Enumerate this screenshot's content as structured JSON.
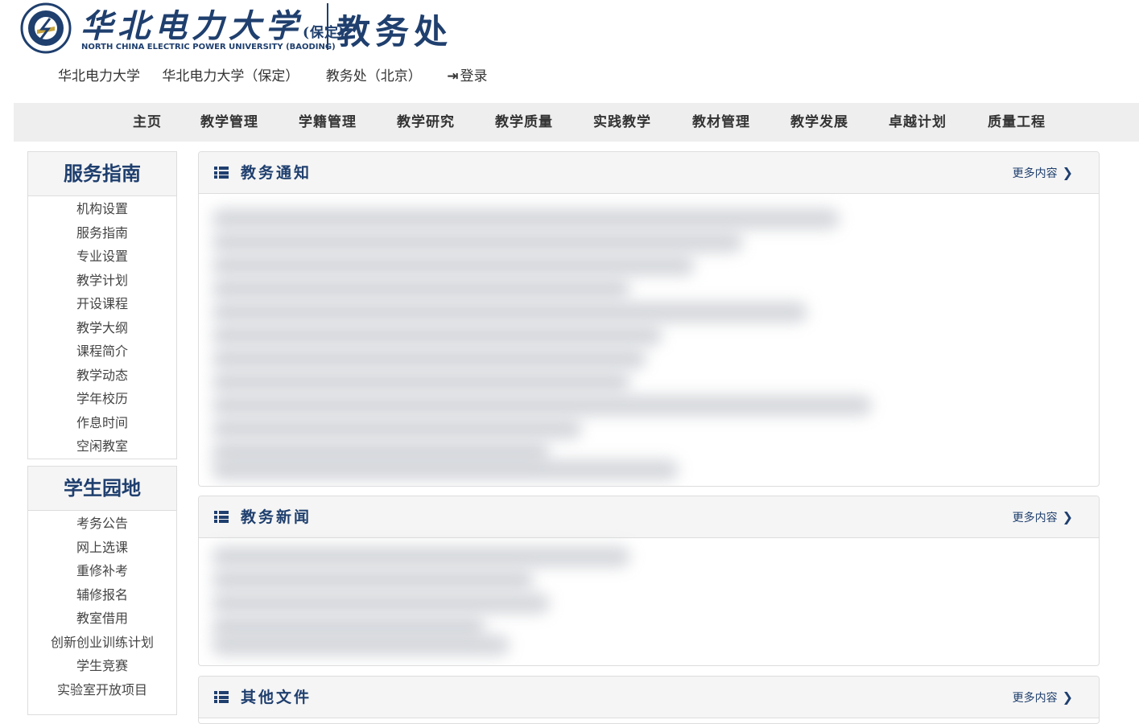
{
  "header": {
    "logo_cn": "华北电力大学",
    "logo_campus": "(保定)",
    "logo_en": "NORTH CHINA ELECTRIC POWER UNIVERSITY (BAODING)",
    "dept": "教务处"
  },
  "top_links": [
    {
      "label": "华北电力大学"
    },
    {
      "label": "华北电力大学（保定）"
    },
    {
      "label": "教务处（北京）"
    },
    {
      "label": "登录"
    }
  ],
  "nav": [
    {
      "label": "主页"
    },
    {
      "label": "教学管理"
    },
    {
      "label": "学籍管理"
    },
    {
      "label": "教学研究"
    },
    {
      "label": "教学质量"
    },
    {
      "label": "实践教学"
    },
    {
      "label": "教材管理"
    },
    {
      "label": "教学发展"
    },
    {
      "label": "卓越计划"
    },
    {
      "label": "质量工程"
    }
  ],
  "sidebar": {
    "service": {
      "title": "服务指南",
      "items": [
        "机构设置",
        "服务指南",
        "专业设置",
        "教学计划",
        "开设课程",
        "教学大纲",
        "课程简介",
        "教学动态",
        "学年校历",
        "作息时间",
        "空闲教室"
      ]
    },
    "student": {
      "title": "学生园地",
      "items": [
        "考务公告",
        "网上选课",
        "重修补考",
        "辅修报名",
        "教室借用",
        "创新创业训练计划",
        "学生竞赛",
        "实验室开放项目"
      ]
    }
  },
  "panels": {
    "notice": {
      "title": "教务通知",
      "more": "更多内容"
    },
    "news": {
      "title": "教务新闻",
      "more": "更多内容"
    },
    "files": {
      "title": "其他文件",
      "more": "更多内容"
    }
  },
  "colors": {
    "brand": "#1f3f6e",
    "nav_bg": "#eeeeee",
    "panel_head_bg": "#f5f5f5"
  }
}
